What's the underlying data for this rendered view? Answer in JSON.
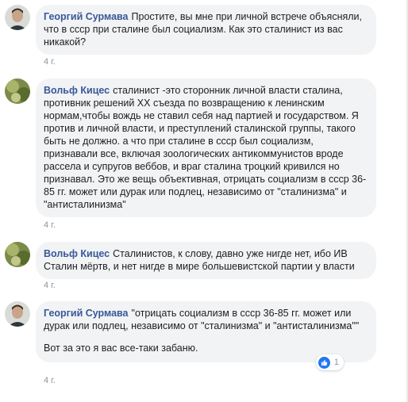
{
  "comments": [
    {
      "author": "Георгий Сурмава",
      "text": "Простите, вы мне при личной встрече объясняли, что в ссср при сталине был социализм. Как это сталинист из вас никакой?",
      "time": "4 г."
    },
    {
      "author": "Вольф Кицес",
      "text": "сталинист -это сторонник личной власти сталина, противник решений XX съезда по возвращению к ленинским нормам,чтобы вождь не ставил себя над партией и государством. Я против и личной власти, и преступлений сталинской группы, такого быть не должно. а что при сталине в ссср был социализм, признавали все, включая зоологических антикоммунистов вроде рассела и супругов веббов, и враг сталина троцкий кривился но признавал. Это же вещь объективная, отрицать социализм в ссср 36-85 гг. может или дурак или подлец, независимо от \"сталинизма\" и \"антисталинизма\"",
      "time": "4 г."
    },
    {
      "author": "Вольф Кицес",
      "text": "Сталинистов, к слову, давно уже нигде нет, ибо ИВ Сталин мёртв, и нет нигде в мире большевистской партии у власти",
      "time": "4 г."
    },
    {
      "author": "Георгий Сурмава",
      "text": "\"отрицать социализм в ссср 36-85 гг. может или дурак или подлец, независимо от \"сталинизма\" и \"антисталинизма\"\"",
      "text2": "Вот за это я вас все-таки забаню.",
      "time": "4 г.",
      "reaction_count": "1"
    }
  ]
}
